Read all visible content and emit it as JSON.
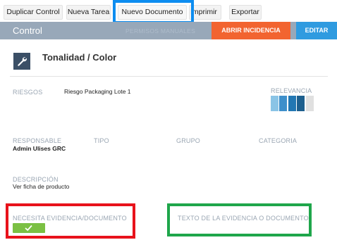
{
  "toolbar": {
    "duplicate_label": "Duplicar Control",
    "new_task_label": "Nueva Tarea",
    "new_document_label": "Nuevo Documento",
    "print_label": "Imprimir",
    "export_label": "Exportar"
  },
  "header": {
    "title": "Control",
    "ghost_text": "PERMISOS MANUALES",
    "incidencia_label": "ABRIR INCIDENCIA",
    "editar_label": "EDITAR",
    "incidencia_color": "#f26430",
    "editar_color": "#2f9be0"
  },
  "control": {
    "icon": "wrench-icon",
    "title": "Tonalidad / Color"
  },
  "fields": {
    "riesgos_label": "RIESGOS",
    "riesgos_value": "Riesgo Packaging Lote 1",
    "relevancia_label": "RELEVANCIA",
    "relevancia_level": 4,
    "relevancia_max": 5,
    "responsable_label": "RESPONSABLE",
    "responsable_value": "Admin Ulises GRC",
    "tipo_label": "TIPO",
    "grupo_label": "GRUPO",
    "categoria_label": "CATEGORIA",
    "descripcion_label": "DESCRIPCIÓN",
    "descripcion_value": "Ver ficha de producto",
    "evidencia_label": "NECESITA EVIDENCIA/DOCUMENTO",
    "evidencia_checked": true,
    "texto_evidencia_label": "TEXTO DE LA EVIDENCIA O DOCUMENTO"
  },
  "colors": {
    "relevance_bars": [
      "#8ac4e6",
      "#3d8fcb",
      "#2277b3",
      "#1d5f8e",
      "#e0e0e0"
    ],
    "check_green": "#7bc043",
    "highlight_blue": "#0d8df0",
    "highlight_red": "#e8121b",
    "highlight_green": "#1fa64b"
  }
}
